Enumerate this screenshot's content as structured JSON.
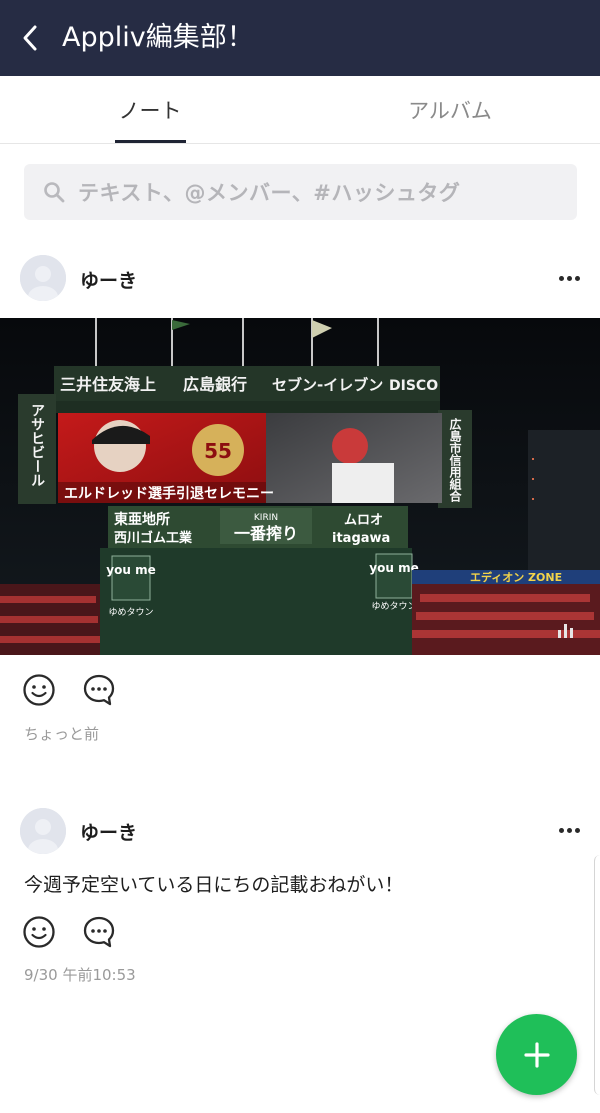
{
  "header": {
    "title": "Appliv編集部！",
    "back_icon": "chevron-left-icon",
    "background_color": "#262c44"
  },
  "tabs": [
    {
      "label": "ノート",
      "active": true
    },
    {
      "label": "アルバム",
      "active": false
    }
  ],
  "search": {
    "placeholder": "テキスト、@メンバー、#ハッシュタグ",
    "icon": "search-icon"
  },
  "posts": [
    {
      "author": "ゆーき",
      "has_photo": true,
      "photo_text": {
        "banner_top_left": "三井住友海上",
        "banner_top_mid": "広島銀行",
        "banner_top_right": "セブン-イレブン",
        "banner_disco": "DISCO",
        "banner_left_vertical": "アサヒビール",
        "banner_right_vertical": "広島市信用組合",
        "screen_caption": "エルドレッド選手引退セレモニー",
        "screen_number": "55",
        "sign_1": "東亜地所",
        "sign_2": "西川ゴム工業",
        "sign_3": "一番搾り",
        "sign_kirin": "KIRIN",
        "sign_4": "ムロオ",
        "sign_5": "itagawa",
        "youme": "you me",
        "youme_town": "ゆめタウン",
        "zone": "エディオン ZONE"
      },
      "timestamp": "ちょっと前"
    },
    {
      "author": "ゆーき",
      "has_photo": false,
      "text": "今週予定空いている日にちの記載おねがい！",
      "timestamp": "9/30 午前10:53"
    }
  ],
  "actions": {
    "react_icon": "smiley-icon",
    "comment_icon": "comment-bubble-icon",
    "more_icon": "more-dots-icon"
  },
  "fab": {
    "icon": "plus-icon",
    "color": "#1fbf59"
  }
}
